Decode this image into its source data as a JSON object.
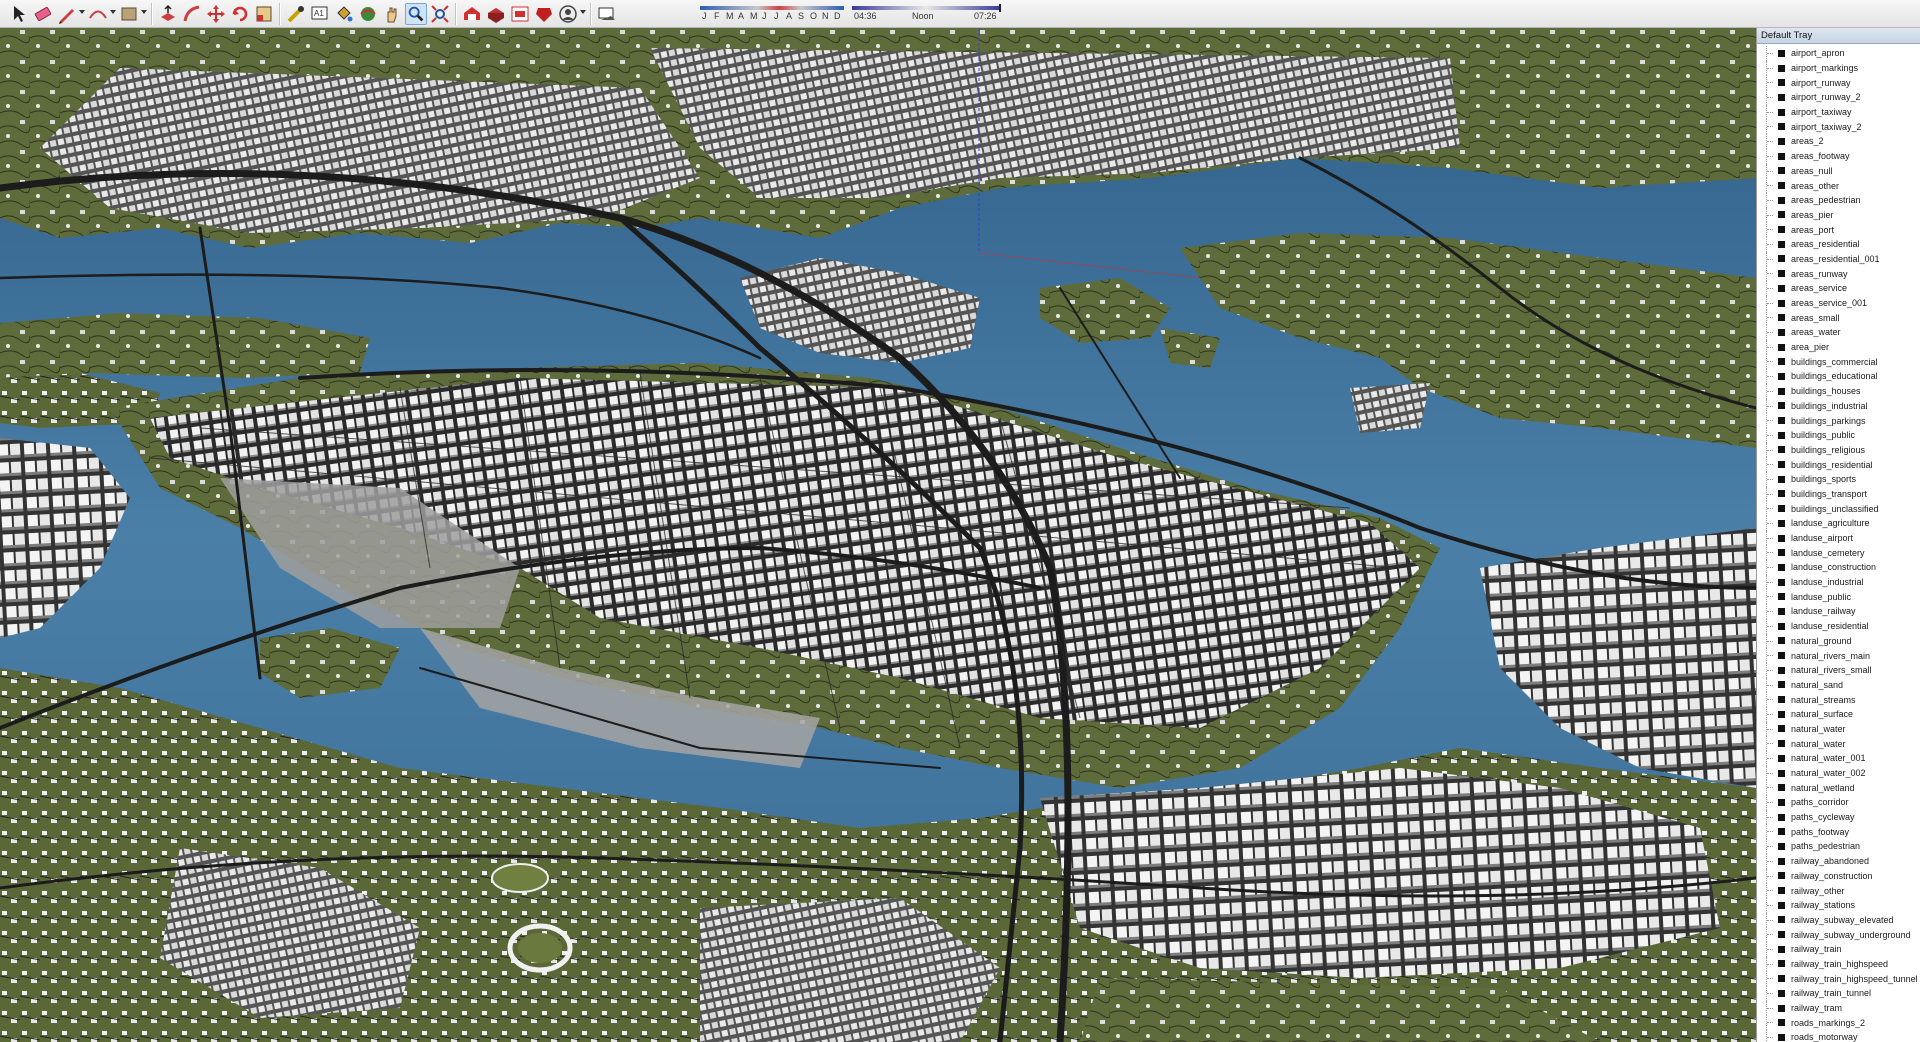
{
  "toolbar": {
    "tools": [
      {
        "name": "select-arrow-icon",
        "dropdown": false
      },
      {
        "name": "eraser-icon",
        "dropdown": false
      },
      {
        "name": "pencil-line-icon",
        "dropdown": true
      },
      {
        "name": "arc-icon",
        "dropdown": true
      },
      {
        "name": "rectangle-icon",
        "dropdown": true
      },
      {
        "name": "push-pull-icon",
        "dropdown": false
      },
      {
        "name": "follow-me-icon",
        "dropdown": false
      },
      {
        "name": "move-icon",
        "dropdown": false
      },
      {
        "name": "rotate-icon",
        "dropdown": false
      },
      {
        "name": "scale-icon",
        "dropdown": false
      },
      {
        "name": "tape-measure-icon",
        "dropdown": false
      },
      {
        "name": "text-label-icon",
        "dropdown": false
      },
      {
        "name": "paint-bucket-icon",
        "dropdown": false
      },
      {
        "name": "orbit-icon",
        "dropdown": false
      },
      {
        "name": "pan-hand-icon",
        "dropdown": false
      },
      {
        "name": "zoom-icon",
        "dropdown": false
      },
      {
        "name": "zoom-extents-icon",
        "dropdown": false
      },
      {
        "name": "warehouse-icon",
        "dropdown": false
      },
      {
        "name": "extension-warehouse-icon",
        "dropdown": false
      },
      {
        "name": "send-to-layout-icon",
        "dropdown": false
      },
      {
        "name": "extension-manager-icon",
        "dropdown": false
      },
      {
        "name": "account-icon",
        "dropdown": true
      },
      {
        "name": "shadows-toggle-icon",
        "dropdown": false
      }
    ],
    "shadow_months": [
      "J",
      "F",
      "M",
      "A",
      "M",
      "J",
      "J",
      "A",
      "S",
      "O",
      "N",
      "D"
    ],
    "shadow_time": {
      "start": "04:36",
      "mid": "Noon",
      "end": "07:26",
      "position_fraction": 0.99
    },
    "colors": {
      "month_bar": "#2d5db5",
      "time_thumb": "#222222"
    }
  },
  "viewport": {
    "colors": {
      "water": "#3d6e97",
      "land": "#5f6b3d",
      "park": "#6a7a3f",
      "building": "#f0f0f0",
      "road": "#262626",
      "paved": "#9e9e9e"
    }
  },
  "tray": {
    "title": "Default Tray",
    "tags": [
      "airport_apron",
      "airport_markings",
      "airport_runway",
      "airport_runway_2",
      "airport_taxiway",
      "airport_taxiway_2",
      "areas_2",
      "areas_footway",
      "areas_null",
      "areas_other",
      "areas_pedestrian",
      "areas_pier",
      "areas_port",
      "areas_residential",
      "areas_residential_001",
      "areas_runway",
      "areas_service",
      "areas_service_001",
      "areas_small",
      "areas_water",
      "area_pier",
      "buildings_commercial",
      "buildings_educational",
      "buildings_houses",
      "buildings_industrial",
      "buildings_parkings",
      "buildings_public",
      "buildings_religious",
      "buildings_residential",
      "buildings_sports",
      "buildings_transport",
      "buildings_unclassified",
      "landuse_agriculture",
      "landuse_airport",
      "landuse_cemetery",
      "landuse_construction",
      "landuse_industrial",
      "landuse_public",
      "landuse_railway",
      "landuse_residential",
      "natural_ground",
      "natural_rivers_main",
      "natural_rivers_small",
      "natural_sand",
      "natural_streams",
      "natural_surface",
      "natural_water",
      "natural_water",
      "natural_water_001",
      "natural_water_002",
      "natural_wetland",
      "paths_corridor",
      "paths_cycleway",
      "paths_footway",
      "paths_pedestrian",
      "railway_abandoned",
      "railway_construction",
      "railway_other",
      "railway_stations",
      "railway_subway_elevated",
      "railway_subway_underground",
      "railway_train",
      "railway_train_highspeed",
      "railway_train_highspeed_tunnel",
      "railway_train_tunnel",
      "railway_tram",
      "roads_markings_2",
      "roads_motorway"
    ]
  }
}
